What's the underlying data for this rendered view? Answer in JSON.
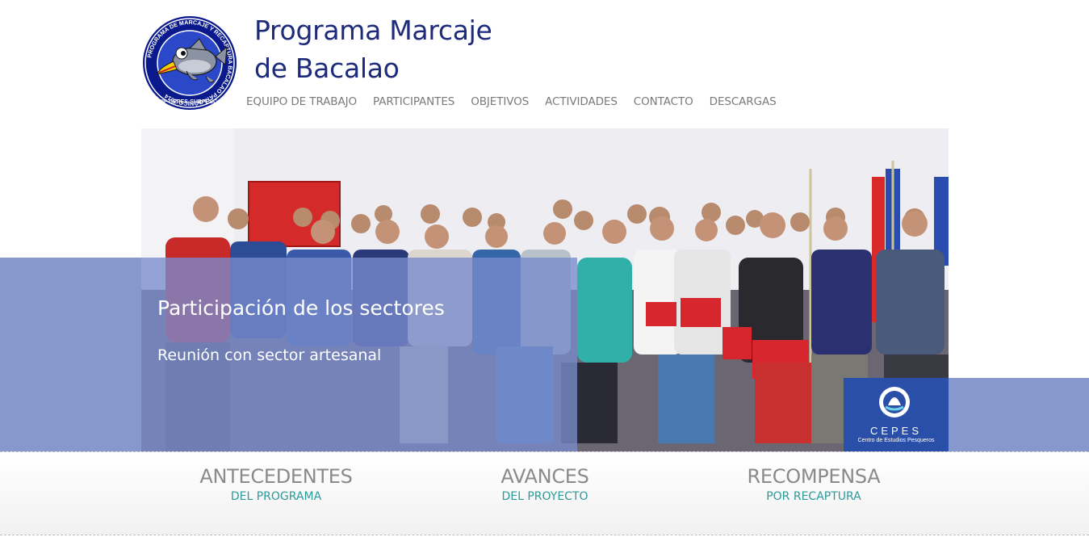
{
  "header": {
    "title_line1": "Programa Marcaje",
    "title_line2": "de Bacalao",
    "logo": {
      "ring_text": "PROGRAMA DE MARCAJE Y RECAPTURA BACALAO PATAGÓNICO 2014",
      "bottom_text": "FIP-CEPES-SUBPESCA",
      "icon": "cod-fish-logo-icon"
    }
  },
  "nav": {
    "items": [
      {
        "label": "EQUIPO DE TRABAJO"
      },
      {
        "label": "PARTICIPANTES"
      },
      {
        "label": "OBJETIVOS"
      },
      {
        "label": "ACTIVIDADES"
      },
      {
        "label": "CONTACTO"
      },
      {
        "label": "DESCARGAS"
      }
    ]
  },
  "slider": {
    "caption_title": "Participación de los sectores",
    "caption_subtitle": "Reunión con sector artesanal",
    "badge": {
      "name": "CEPES",
      "subtitle": "Centro de Estudios Pesqueros",
      "icon": "cepes-logo-icon"
    }
  },
  "features": [
    {
      "title": "ANTECEDENTES",
      "subtitle": "DEL PROGRAMA"
    },
    {
      "title": "AVANCES",
      "subtitle": "DEL PROYECTO"
    },
    {
      "title": "RECOMPENSA",
      "subtitle": "POR RECAPTURA"
    }
  ],
  "colors": {
    "title_blue": "#1e2a7a",
    "nav_gray": "#7a7a7a",
    "band_blue": "#8798cf",
    "feature_gray": "#8a8a8a",
    "feature_teal": "#2a9a9a"
  }
}
